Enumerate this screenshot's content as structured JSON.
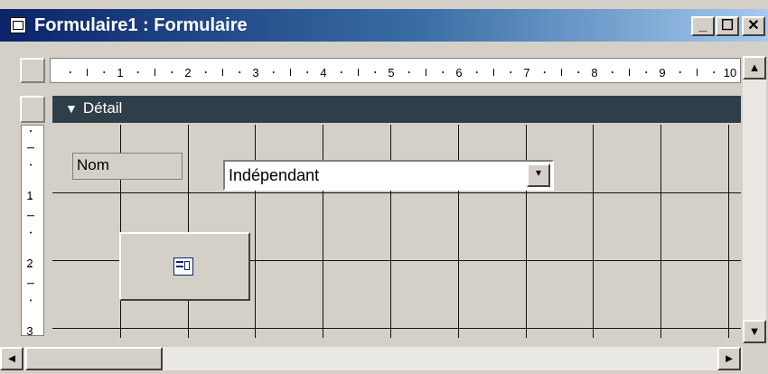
{
  "window": {
    "title": "Formulaire1 : Formulaire",
    "icon": "form-icon",
    "controls": {
      "minimize": "_",
      "maximize": "☐",
      "close": "✕"
    }
  },
  "ruler": {
    "horizontal_numbers": [
      "1",
      "2",
      "3",
      "4",
      "5",
      "6",
      "7",
      "8",
      "9",
      "10"
    ],
    "vertical_numbers": [
      "1",
      "2",
      "3"
    ]
  },
  "section": {
    "arrow": "▼",
    "label": "Détail"
  },
  "controls_on_form": {
    "label_nom": "Nom",
    "combo_value": "Indépendant",
    "combo_arrow": "▾",
    "subform_icon": "form-icon"
  },
  "scrollbars": {
    "up": "▲",
    "down": "▼",
    "left": "◄",
    "right": "►"
  },
  "colors": {
    "title_start": "#0a246a",
    "title_end": "#a6caf0",
    "section_bar": "#2f3f4a",
    "form_bg": "#d4d0c8"
  }
}
